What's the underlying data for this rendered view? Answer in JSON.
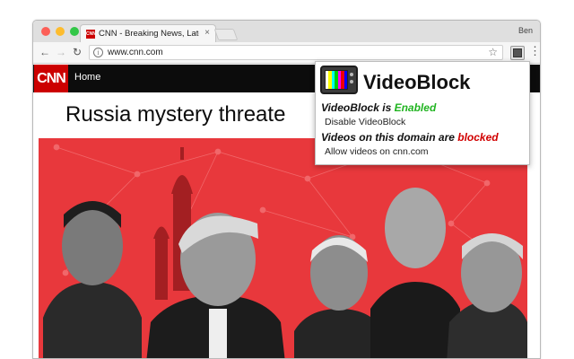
{
  "browser": {
    "tab_title": "CNN - Breaking News, Latest N",
    "tab_close": "×",
    "favicon_text": "CNN",
    "user_name": "Ben",
    "url": "www.cnn.com",
    "info_icon": "i",
    "star_icon": "☆",
    "menu_icon": "⋮",
    "back_icon": "←",
    "forward_icon": "→",
    "reload_icon": "↻"
  },
  "cnn": {
    "logo": "CNN",
    "nav_home": "Home",
    "headline": "Russia mystery threate"
  },
  "popup": {
    "title": "VideoBlock",
    "status_prefix": "VideoBlock is ",
    "status_value": "Enabled",
    "disable_link": "Disable VideoBlock",
    "domain_prefix": "Videos on this domain are ",
    "domain_value": "blocked",
    "allow_link": "Allow videos on cnn.com"
  },
  "colors": {
    "cnn_red": "#cc0000",
    "hero_red": "#e8383c",
    "enabled_green": "#21b421",
    "blocked_red": "#d10000"
  }
}
